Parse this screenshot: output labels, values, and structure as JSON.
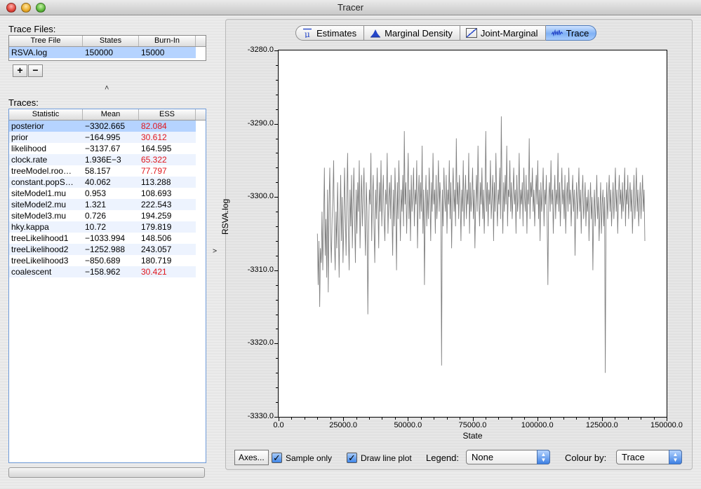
{
  "window": {
    "title": "Tracer"
  },
  "trace_files": {
    "label": "Trace Files:",
    "columns": [
      "Tree File",
      "States",
      "Burn-In"
    ],
    "rows": [
      {
        "file": "RSVA.log",
        "states": "150000",
        "burnin": "15000"
      }
    ],
    "add_label": "+",
    "remove_label": "−"
  },
  "traces": {
    "label": "Traces:",
    "columns": [
      "Statistic",
      "Mean",
      "ESS"
    ],
    "rows": [
      {
        "statistic": "posterior",
        "mean": "−3302.665",
        "ess": "82.084",
        "low_ess": true
      },
      {
        "statistic": "prior",
        "mean": "−164.995",
        "ess": "30.612",
        "low_ess": true
      },
      {
        "statistic": "likelihood",
        "mean": "−3137.67",
        "ess": "164.595",
        "low_ess": false
      },
      {
        "statistic": "clock.rate",
        "mean": "1.936E−3",
        "ess": "65.322",
        "low_ess": true
      },
      {
        "statistic": "treeModel.roo…",
        "mean": "58.157",
        "ess": "77.797",
        "low_ess": true
      },
      {
        "statistic": "constant.popS…",
        "mean": "40.062",
        "ess": "113.288",
        "low_ess": false
      },
      {
        "statistic": "siteModel1.mu",
        "mean": "0.953",
        "ess": "108.693",
        "low_ess": false
      },
      {
        "statistic": "siteModel2.mu",
        "mean": "1.321",
        "ess": "222.543",
        "low_ess": false
      },
      {
        "statistic": "siteModel3.mu",
        "mean": "0.726",
        "ess": "194.259",
        "low_ess": false
      },
      {
        "statistic": "hky.kappa",
        "mean": "10.72",
        "ess": "179.819",
        "low_ess": false
      },
      {
        "statistic": "treeLikelihood1",
        "mean": "−1033.994",
        "ess": "148.506",
        "low_ess": false
      },
      {
        "statistic": "treeLikelihood2",
        "mean": "−1252.988",
        "ess": "243.057",
        "low_ess": false
      },
      {
        "statistic": "treeLikelihood3",
        "mean": "−850.689",
        "ess": "180.719",
        "low_ess": false
      },
      {
        "statistic": "coalescent",
        "mean": "−158.962",
        "ess": "30.421",
        "low_ess": true
      }
    ]
  },
  "tabs": [
    {
      "label": "Estimates",
      "icon": "mu-icon",
      "active": false
    },
    {
      "label": "Marginal Density",
      "icon": "density-icon",
      "active": false
    },
    {
      "label": "Joint-Marginal",
      "icon": "joint-marginal-icon",
      "active": false
    },
    {
      "label": "Trace",
      "icon": "trace-icon",
      "active": true
    }
  ],
  "controls": {
    "axes_label": "Axes...",
    "sample_only_label": "Sample only",
    "sample_only_checked": true,
    "draw_line_label": "Draw line plot",
    "draw_line_checked": true,
    "legend_label": "Legend:",
    "legend_value": "None",
    "colour_by_label": "Colour by:",
    "colour_by_value": "Trace"
  },
  "colors": {
    "selected_row": "#b5d3ff",
    "low_ess": "#e0161c",
    "trace_line": "#808080",
    "active_tab": "#7fb1f5"
  },
  "chart_data": {
    "type": "line",
    "title": "",
    "xlabel": "State",
    "ylabel": "RSVA.log",
    "xlim": [
      0,
      150000
    ],
    "ylim": [
      -3330,
      -3280
    ],
    "x_ticks": [
      "0.0",
      "25000.0",
      "50000.0",
      "75000.0",
      "100000.0",
      "125000.0",
      "150000.0"
    ],
    "y_ticks": [
      "-3280.0",
      "-3290.0",
      "-3300.0",
      "-3310.0",
      "-3320.0",
      "-3330.0"
    ],
    "grid": false,
    "series": [
      {
        "color": "#808080",
        "x_start": 15000,
        "x_step": 300,
        "y": [
          -3305,
          -3312,
          -3306,
          -3315,
          -3307,
          -3309,
          -3302,
          -3310,
          -3304,
          -3296,
          -3308,
          -3303,
          -3311,
          -3299,
          -3313,
          -3301,
          -3296,
          -3305,
          -3309,
          -3303,
          -3300,
          -3295,
          -3306,
          -3310,
          -3302,
          -3307,
          -3298,
          -3304,
          -3311,
          -3303,
          -3297,
          -3306,
          -3300,
          -3309,
          -3304,
          -3296,
          -3302,
          -3308,
          -3300,
          -3294,
          -3305,
          -3310,
          -3299,
          -3304,
          -3297,
          -3307,
          -3301,
          -3296,
          -3303,
          -3309,
          -3299,
          -3305,
          -3298,
          -3302,
          -3295,
          -3307,
          -3301,
          -3297,
          -3304,
          -3300,
          -3296,
          -3303,
          -3308,
          -3298,
          -3302,
          -3316,
          -3305,
          -3299,
          -3301,
          -3294,
          -3306,
          -3300,
          -3297,
          -3304,
          -3309,
          -3299,
          -3303,
          -3296,
          -3301,
          -3307,
          -3298,
          -3302,
          -3295,
          -3304,
          -3300,
          -3297,
          -3303,
          -3306,
          -3299,
          -3301,
          -3294,
          -3305,
          -3300,
          -3298,
          -3303,
          -3297,
          -3302,
          -3308,
          -3299,
          -3304,
          -3296,
          -3301,
          -3310,
          -3298,
          -3303,
          -3295,
          -3300,
          -3306,
          -3299,
          -3302,
          -3297,
          -3304,
          -3291,
          -3301,
          -3298,
          -3305,
          -3300,
          -3294,
          -3303,
          -3299,
          -3306,
          -3297,
          -3302,
          -3300,
          -3296,
          -3304,
          -3299,
          -3301,
          -3295,
          -3307,
          -3300,
          -3297,
          -3303,
          -3298,
          -3302,
          -3293,
          -3305,
          -3299,
          -3312,
          -3301,
          -3297,
          -3304,
          -3299,
          -3303,
          -3296,
          -3300,
          -3306,
          -3298,
          -3302,
          -3294,
          -3301,
          -3299,
          -3305,
          -3297,
          -3303,
          -3300,
          -3295,
          -3302,
          -3298,
          -3301,
          -3323,
          -3299,
          -3304,
          -3296,
          -3300,
          -3302,
          -3297,
          -3305,
          -3299,
          -3301,
          -3295,
          -3303,
          -3298,
          -3307,
          -3300,
          -3296,
          -3302,
          -3299,
          -3304,
          -3292,
          -3301,
          -3298,
          -3303,
          -3297,
          -3300,
          -3306,
          -3299,
          -3302,
          -3295,
          -3304,
          -3300,
          -3297,
          -3303,
          -3299,
          -3301,
          -3294,
          -3305,
          -3298,
          -3302,
          -3300,
          -3296,
          -3303,
          -3299,
          -3307,
          -3301,
          -3297,
          -3302,
          -3293,
          -3300,
          -3304,
          -3298,
          -3301,
          -3296,
          -3303,
          -3299,
          -3305,
          -3300,
          -3291,
          -3302,
          -3298,
          -3304,
          -3299,
          -3301,
          -3295,
          -3303,
          -3300,
          -3297,
          -3306,
          -3298,
          -3302,
          -3294,
          -3300,
          -3304,
          -3299,
          -3301,
          -3296,
          -3303,
          -3289,
          -3300,
          -3305,
          -3298,
          -3302,
          -3297,
          -3301,
          -3293,
          -3304,
          -3299,
          -3300,
          -3295,
          -3302,
          -3298,
          -3303,
          -3300,
          -3296,
          -3301,
          -3299,
          -3305,
          -3297,
          -3302,
          -3300,
          -3294,
          -3303,
          -3299,
          -3301,
          -3298,
          -3304,
          -3296,
          -3300,
          -3302,
          -3297,
          -3305,
          -3299,
          -3301,
          -3292,
          -3303,
          -3298,
          -3300,
          -3296,
          -3302,
          -3299,
          -3304,
          -3300,
          -3297,
          -3301,
          -3295,
          -3303,
          -3299,
          -3306,
          -3298,
          -3302,
          -3300,
          -3296,
          -3304,
          -3299,
          -3301,
          -3297,
          -3303,
          -3312,
          -3300,
          -3298,
          -3302,
          -3295,
          -3301,
          -3299,
          -3305,
          -3300,
          -3297,
          -3303,
          -3299,
          -3301,
          -3294,
          -3302,
          -3298,
          -3304,
          -3300,
          -3296,
          -3301,
          -3299,
          -3303,
          -3297,
          -3305,
          -3300,
          -3298,
          -3302,
          -3296,
          -3301,
          -3299,
          -3304,
          -3300,
          -3297,
          -3302,
          -3299,
          -3308,
          -3301,
          -3298,
          -3303,
          -3300,
          -3296,
          -3302,
          -3299,
          -3305,
          -3300,
          -3297,
          -3303,
          -3301,
          -3298,
          -3304,
          -3300,
          -3302,
          -3299,
          -3306,
          -3301,
          -3298,
          -3303,
          -3300,
          -3310,
          -3302,
          -3299,
          -3304,
          -3301,
          -3297,
          -3303,
          -3300,
          -3306,
          -3302,
          -3298,
          -3305,
          -3301,
          -3299,
          -3304,
          -3300,
          -3324,
          -3302,
          -3298,
          -3303,
          -3300,
          -3297,
          -3302,
          -3299,
          -3304,
          -3301,
          -3298,
          -3303,
          -3300,
          -3296,
          -3302,
          -3299,
          -3305,
          -3300,
          -3297,
          -3301,
          -3299,
          -3303,
          -3298,
          -3302,
          -3300,
          -3296,
          -3304,
          -3299,
          -3301,
          -3297,
          -3303,
          -3300,
          -3298,
          -3302,
          -3299,
          -3305,
          -3301,
          -3297,
          -3303,
          -3300,
          -3296,
          -3302,
          -3299,
          -3304,
          -3301,
          -3298,
          -3303,
          -3300,
          -3297,
          -3302,
          -3299,
          -3306
        ]
      }
    ]
  }
}
